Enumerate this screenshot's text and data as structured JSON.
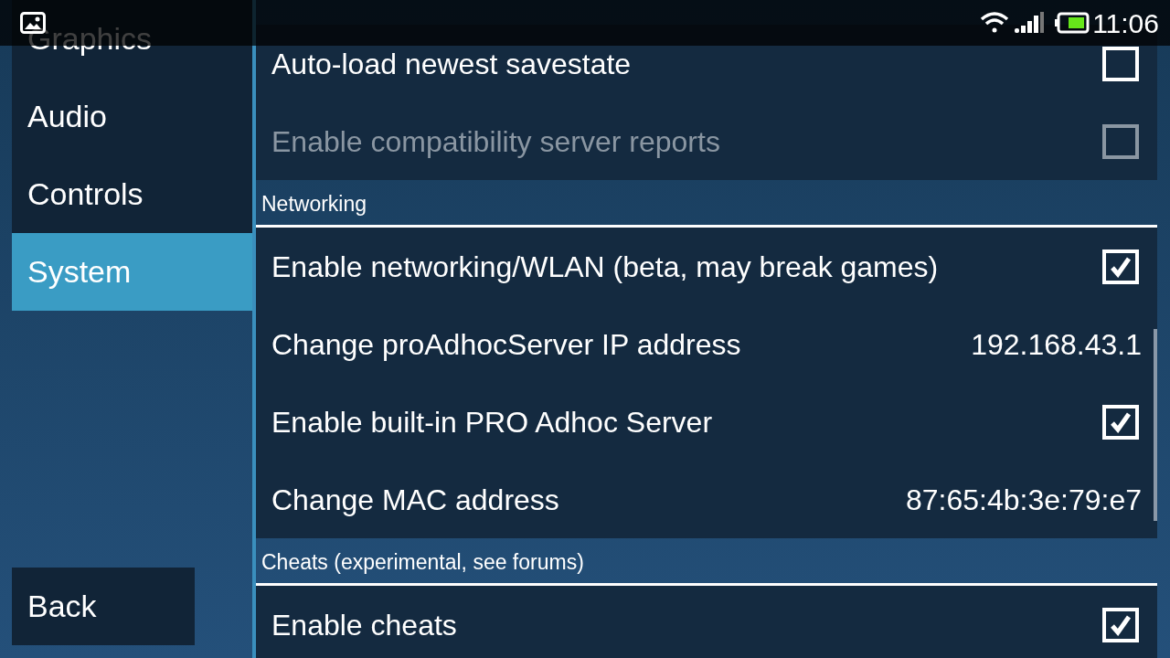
{
  "status_bar": {
    "time": "11:06"
  },
  "sidebar": {
    "items": [
      {
        "label": "Graphics",
        "selected": false
      },
      {
        "label": "Audio",
        "selected": false
      },
      {
        "label": "Controls",
        "selected": false
      },
      {
        "label": "System",
        "selected": true
      }
    ],
    "back_button": "Back"
  },
  "settings": [
    {
      "kind": "checkbox",
      "label": "Auto-load newest savestate",
      "checked": false,
      "disabled": false
    },
    {
      "kind": "checkbox",
      "label": "Enable compatibility server reports",
      "checked": false,
      "disabled": true
    },
    {
      "kind": "header",
      "label": "Networking"
    },
    {
      "kind": "checkbox",
      "label": "Enable networking/WLAN (beta, may break games)",
      "checked": true,
      "disabled": false
    },
    {
      "kind": "value",
      "label": "Change proAdhocServer IP address",
      "value": "192.168.43.1",
      "disabled": false
    },
    {
      "kind": "checkbox",
      "label": "Enable built-in PRO Adhoc Server",
      "checked": true,
      "disabled": false
    },
    {
      "kind": "value",
      "label": "Change MAC address",
      "value": "87:65:4b:3e:79:e7",
      "disabled": false
    },
    {
      "kind": "header",
      "label": "Cheats (experimental, see forums)"
    },
    {
      "kind": "checkbox",
      "label": "Enable cheats",
      "checked": true,
      "disabled": false
    }
  ]
}
